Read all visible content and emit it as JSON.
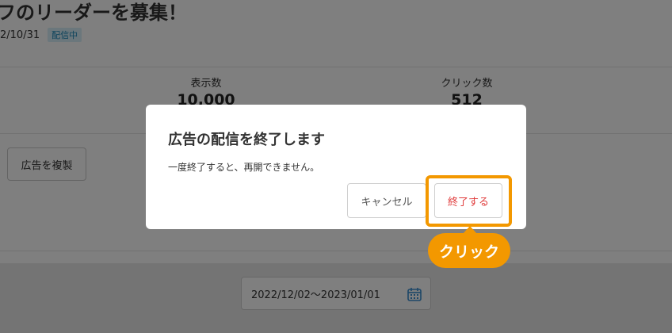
{
  "page": {
    "title": "フのリーダーを募集！",
    "date": "2/10/31",
    "status_badge": "配信中"
  },
  "stats": [
    {
      "label": "表示数",
      "value": "10,000"
    },
    {
      "label": "クリック数",
      "value": "512"
    }
  ],
  "actions": {
    "copy_label": "広告を複製"
  },
  "filter": {
    "date_range": "2022/12/02〜2023/01/01",
    "calendar_icon": "calendar-icon"
  },
  "dialog": {
    "title": "広告の配信を終了します",
    "message": "一度終了すると、再開できません。",
    "cancel_label": "キャンセル",
    "confirm_label": "終了する"
  },
  "annotation": {
    "callout_label": "クリック",
    "color": "#f39800"
  },
  "colors": {
    "overlay": "rgba(0,0,0,0.5)",
    "badge_bg": "#d6eef8",
    "badge_text": "#1a86b8",
    "danger": "#e03b3b"
  }
}
